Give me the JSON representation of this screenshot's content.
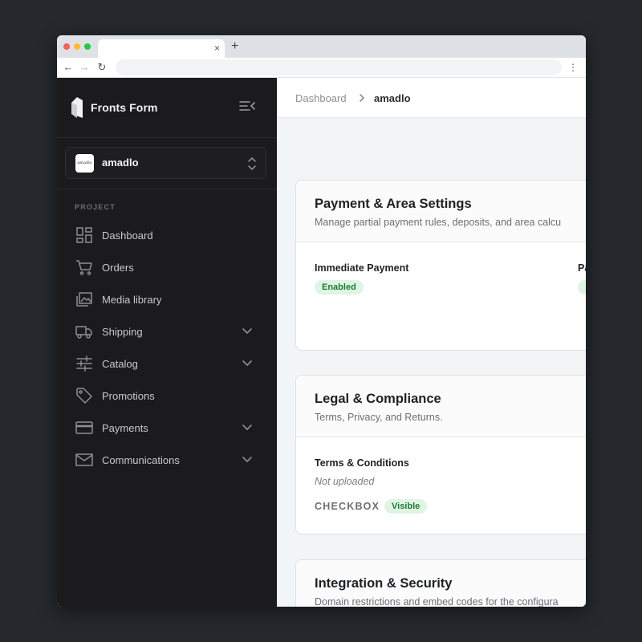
{
  "browser": {
    "tab_close": "×",
    "new_tab": "+",
    "back": "←",
    "forward": "→",
    "reload": "↻",
    "menu": "⋮"
  },
  "sidebar": {
    "brand": "Fronts Form",
    "store": {
      "logo_text": "amadlo",
      "name": "amadlo"
    },
    "section_label": "PROJECT",
    "items": [
      {
        "label": "Dashboard",
        "icon": "dashboard-icon",
        "expandable": false
      },
      {
        "label": "Orders",
        "icon": "cart-icon",
        "expandable": false
      },
      {
        "label": "Media library",
        "icon": "media-icon",
        "expandable": false
      },
      {
        "label": "Shipping",
        "icon": "truck-icon",
        "expandable": true
      },
      {
        "label": "Catalog",
        "icon": "sliders-icon",
        "expandable": true
      },
      {
        "label": "Promotions",
        "icon": "tag-icon",
        "expandable": false
      },
      {
        "label": "Payments",
        "icon": "card-icon",
        "expandable": true
      },
      {
        "label": "Communications",
        "icon": "mail-icon",
        "expandable": true
      }
    ]
  },
  "breadcrumb": {
    "root": "Dashboard",
    "current": "amadlo"
  },
  "cards": {
    "payment": {
      "title": "Payment & Area Settings",
      "subtitle": "Manage partial payment rules, deposits, and area calcu",
      "field1_label": "Immediate Payment",
      "field1_badge": "Enabled",
      "field2_label": "Pa"
    },
    "legal": {
      "title": "Legal & Compliance",
      "subtitle": "Terms, Privacy, and Returns.",
      "field_label": "Terms & Conditions",
      "field_status": "Not uploaded",
      "mode": "CHECKBOX",
      "visibility": "Visible"
    },
    "integration": {
      "title": "Integration & Security",
      "subtitle": "Domain restrictions and embed codes for the configura"
    }
  },
  "colors": {
    "sidebar_bg": "#1b1b1d",
    "badge_bg": "#dff5e4",
    "badge_text": "#1d7a36"
  }
}
